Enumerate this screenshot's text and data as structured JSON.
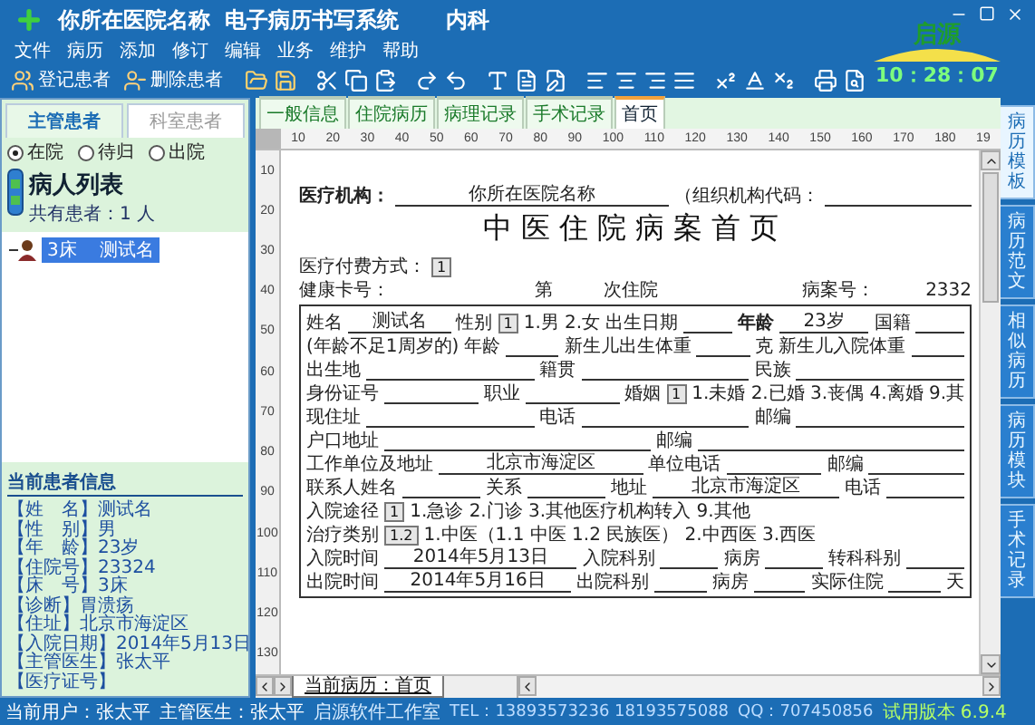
{
  "window": {
    "hospital": "你所在医院名称",
    "system": "电子病历书写系统",
    "department": "内科"
  },
  "menu": [
    "文件",
    "病历",
    "添加",
    "修订",
    "编辑",
    "业务",
    "维护",
    "帮助"
  ],
  "toolbar": {
    "buttons": [
      {
        "kind": "add",
        "label": "登记患者"
      },
      {
        "kind": "remove",
        "label": "删除患者"
      }
    ]
  },
  "logo": {
    "text": "启源"
  },
  "clock": "10：28：07",
  "patient_panel": {
    "tabs": [
      {
        "label": "主管患者",
        "selected": true
      },
      {
        "label": "科室患者",
        "selected": false
      }
    ],
    "filters": [
      {
        "label": "在院",
        "selected": true
      },
      {
        "label": "待归",
        "selected": false
      },
      {
        "label": "出院",
        "selected": false
      }
    ],
    "list_title": "病人列表",
    "count": "共有患者：1 人",
    "patients": [
      {
        "bed": "3床",
        "name": "测试名",
        "selected": true
      }
    ]
  },
  "current_patient": {
    "title": "当前患者信息",
    "lines": [
      "【姓　名】测试名",
      "【性　别】男",
      "【年　龄】23岁",
      "【住院号】23324",
      "【床　号】3床",
      "【诊断】胃溃疡",
      "【住址】北京市海淀区",
      "【入院日期】2014年5月13日",
      "【主管医生】张太平",
      "【医疗证号】"
    ]
  },
  "editor": {
    "tabs": [
      {
        "label": "一般信息",
        "selected": false
      },
      {
        "label": "住院病历",
        "selected": false
      },
      {
        "label": "病理记录",
        "selected": false
      },
      {
        "label": "手术记录",
        "selected": false
      },
      {
        "label": "首页",
        "selected": true
      }
    ],
    "ruler": [
      "10",
      "20",
      "30",
      "40",
      "50",
      "60",
      "70",
      "80",
      "90",
      "100",
      "110",
      "120",
      "130",
      "140",
      "150",
      "160",
      "170",
      "180",
      "19"
    ],
    "vertical_ruler": [
      "10",
      "20",
      "30",
      "40",
      "50",
      "60",
      "70",
      "80",
      "90",
      "100",
      "110",
      "120",
      "130"
    ],
    "sheet_tab": "当前病历：首页"
  },
  "document": {
    "title": "中医住院病案首页",
    "header_rows": [
      [
        {
          "kind": "strong",
          "text": "医疗机构："
        },
        {
          "kind": "field",
          "value": "你所在医院名称"
        },
        {
          "kind": "label",
          "text": "（组织机构代码："
        },
        {
          "kind": "field"
        }
      ],
      [
        {
          "kind": "label",
          "text": "医疗付费方式："
        },
        {
          "kind": "code",
          "value": "1"
        },
        {
          "kind": "gap"
        }
      ],
      [
        {
          "kind": "label",
          "text": "健康卡号："
        },
        {
          "kind": "gap"
        },
        {
          "kind": "label",
          "text": "第"
        },
        {
          "kind": "space"
        },
        {
          "kind": "label",
          "text": "次住院"
        },
        {
          "kind": "gap"
        },
        {
          "kind": "label",
          "text": "病案号："
        },
        {
          "kind": "space"
        },
        {
          "kind": "label",
          "text": "2332"
        }
      ]
    ],
    "table_rows": [
      [
        {
          "kind": "label",
          "text": "姓名"
        },
        {
          "kind": "field",
          "value": "测试名"
        },
        {
          "kind": "label",
          "text": "性别"
        },
        {
          "kind": "code",
          "value": "1"
        },
        {
          "kind": "label",
          "text": "1.男 2.女"
        },
        {
          "kind": "label",
          "text": "出生日期"
        },
        {
          "kind": "field"
        },
        {
          "kind": "strong",
          "text": "年龄"
        },
        {
          "kind": "field",
          "value": "23岁"
        },
        {
          "kind": "label",
          "text": "国籍"
        },
        {
          "kind": "field"
        }
      ],
      [
        {
          "kind": "label",
          "text": "(年龄不足1周岁的)"
        },
        {
          "kind": "label",
          "text": "年龄"
        },
        {
          "kind": "field"
        },
        {
          "kind": "label",
          "text": "新生儿出生体重"
        },
        {
          "kind": "field"
        },
        {
          "kind": "label",
          "text": "克"
        },
        {
          "kind": "label",
          "text": "新生儿入院体重"
        },
        {
          "kind": "field"
        }
      ],
      [
        {
          "kind": "label",
          "text": "出生地"
        },
        {
          "kind": "field"
        },
        {
          "kind": "label",
          "text": "籍贯"
        },
        {
          "kind": "field"
        },
        {
          "kind": "label",
          "text": "民族"
        },
        {
          "kind": "field"
        }
      ],
      [
        {
          "kind": "label",
          "text": "身份证号"
        },
        {
          "kind": "field"
        },
        {
          "kind": "label",
          "text": "职业"
        },
        {
          "kind": "field"
        },
        {
          "kind": "label",
          "text": "婚姻"
        },
        {
          "kind": "code",
          "value": "1"
        },
        {
          "kind": "label",
          "text": "1.未婚 2.已婚 3.丧偶 4.离婚 9.其"
        }
      ],
      [
        {
          "kind": "label",
          "text": "现住址"
        },
        {
          "kind": "field"
        },
        {
          "kind": "label",
          "text": "电话"
        },
        {
          "kind": "field"
        },
        {
          "kind": "label",
          "text": "邮编"
        },
        {
          "kind": "field"
        }
      ],
      [
        {
          "kind": "label",
          "text": "户口地址"
        },
        {
          "kind": "field"
        },
        {
          "kind": "label",
          "text": "邮编"
        },
        {
          "kind": "field"
        }
      ],
      [
        {
          "kind": "label",
          "text": "工作单位及地址"
        },
        {
          "kind": "field",
          "value": "北京市海淀区"
        },
        {
          "kind": "label",
          "text": "单位电话"
        },
        {
          "kind": "field"
        },
        {
          "kind": "label",
          "text": "邮编"
        },
        {
          "kind": "field"
        }
      ],
      [
        {
          "kind": "label",
          "text": "联系人姓名"
        },
        {
          "kind": "field"
        },
        {
          "kind": "label",
          "text": "关系"
        },
        {
          "kind": "field"
        },
        {
          "kind": "label",
          "text": "地址"
        },
        {
          "kind": "field",
          "value": "北京市海淀区"
        },
        {
          "kind": "label",
          "text": "电话"
        },
        {
          "kind": "field"
        }
      ],
      [
        {
          "kind": "label",
          "text": "入院途径"
        },
        {
          "kind": "code",
          "value": "1"
        },
        {
          "kind": "label",
          "text": "1.急诊 2.门诊 3.其他医疗机构转入 9.其他"
        },
        {
          "kind": "gap"
        }
      ],
      [
        {
          "kind": "label",
          "text": "治疗类别"
        },
        {
          "kind": "code",
          "value": "1.2"
        },
        {
          "kind": "label",
          "text": "1.中医（1.1 中医 1.2 民族医） 2.中西医 3.西医"
        },
        {
          "kind": "gap"
        }
      ],
      [
        {
          "kind": "label",
          "text": "入院时间"
        },
        {
          "kind": "field",
          "value": "2014年5月13日"
        },
        {
          "kind": "label",
          "text": "入院科别"
        },
        {
          "kind": "field"
        },
        {
          "kind": "label",
          "text": "病房"
        },
        {
          "kind": "field"
        },
        {
          "kind": "label",
          "text": "转科科别"
        },
        {
          "kind": "field"
        }
      ],
      [
        {
          "kind": "label",
          "text": "出院时间"
        },
        {
          "kind": "field",
          "value": "2014年5月16日"
        },
        {
          "kind": "label",
          "text": "出院科别"
        },
        {
          "kind": "field"
        },
        {
          "kind": "label",
          "text": "病房"
        },
        {
          "kind": "field"
        },
        {
          "kind": "label",
          "text": "实际住院"
        },
        {
          "kind": "field"
        },
        {
          "kind": "label",
          "text": "天"
        }
      ]
    ]
  },
  "side_tabs": [
    {
      "label": "病历模板",
      "selected": true
    },
    {
      "label": "病历范文",
      "selected": false
    },
    {
      "label": "相似病历",
      "selected": false
    },
    {
      "label": "病历模块",
      "selected": false
    },
    {
      "label": "手术记录",
      "selected": false
    }
  ],
  "status_bar": [
    {
      "kind": "user",
      "text": "当前用户：张太平"
    },
    {
      "kind": "user",
      "text": "主管医生：张太平"
    },
    {
      "kind": "studio",
      "text": "启源软件工作室"
    },
    {
      "kind": "contact",
      "text": "TEL：13893573236 18193575088"
    },
    {
      "kind": "contact",
      "text": "QQ：707450856"
    },
    {
      "kind": "version",
      "text": "试用版本 6.9.4"
    }
  ]
}
